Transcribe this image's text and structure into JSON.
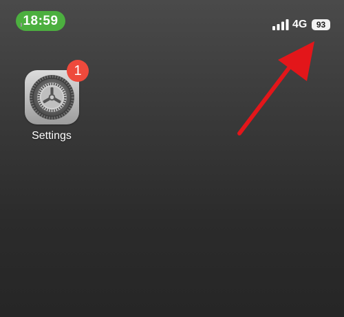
{
  "status_bar": {
    "time": "18:59",
    "time_pill_color": "#4caf3f",
    "signal_icon": "signal-bars-icon",
    "network": "4G",
    "battery_level": "93",
    "battery_icon": "battery-icon"
  },
  "home_screen": {
    "apps": [
      {
        "label": "Settings",
        "icon": "gear-icon",
        "badge": "1",
        "badge_color": "#ee4a3c"
      }
    ]
  },
  "annotation": {
    "arrow_color": "#e3161a",
    "arrow_target": "battery-indicator"
  }
}
